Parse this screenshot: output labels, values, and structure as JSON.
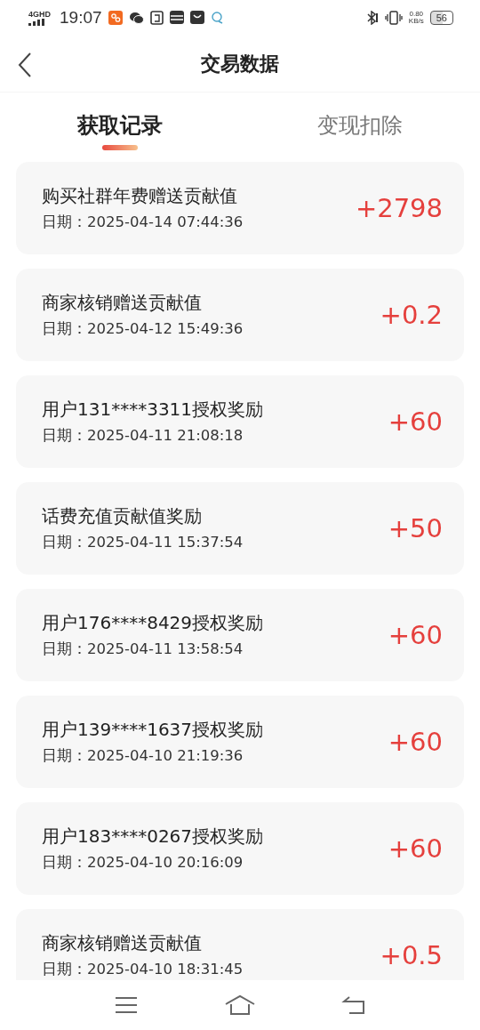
{
  "status_bar": {
    "network": "4G",
    "network_sub": "HD",
    "time": "19:07",
    "speed_value": "0.80",
    "speed_unit": "KB/s",
    "battery": "56"
  },
  "header": {
    "title": "交易数据"
  },
  "tabs": [
    {
      "label": "获取记录",
      "selected": true
    },
    {
      "label": "变现扣除",
      "selected": false
    }
  ],
  "records": [
    {
      "title": "购买社群年费赠送贡献值",
      "date": "日期：2025-04-14 07:44:36",
      "amount": "+2798"
    },
    {
      "title": "商家核销赠送贡献值",
      "date": "日期：2025-04-12 15:49:36",
      "amount": "+0.2"
    },
    {
      "title": "用户131****3311授权奖励",
      "date": "日期：2025-04-11 21:08:18",
      "amount": "+60"
    },
    {
      "title": "话费充值贡献值奖励",
      "date": "日期：2025-04-11 15:37:54",
      "amount": "+50"
    },
    {
      "title": "用户176****8429授权奖励",
      "date": "日期：2025-04-11 13:58:54",
      "amount": "+60"
    },
    {
      "title": "用户139****1637授权奖励",
      "date": "日期：2025-04-10 21:19:36",
      "amount": "+60"
    },
    {
      "title": "用户183****0267授权奖励",
      "date": "日期：2025-04-10 20:16:09",
      "amount": "+60"
    },
    {
      "title": "商家核销赠送贡献值",
      "date": "日期：2025-04-10 18:31:45",
      "amount": "+0.5"
    }
  ]
}
